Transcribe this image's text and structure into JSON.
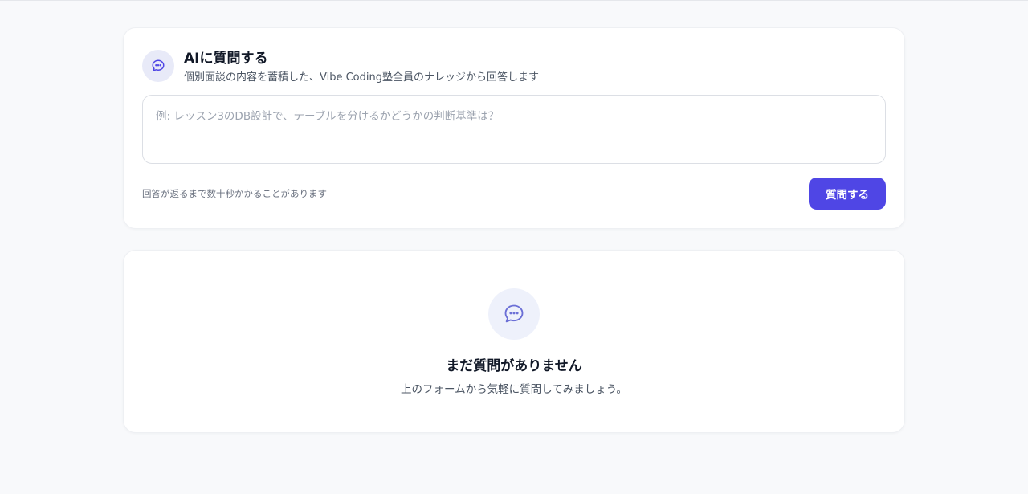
{
  "ask": {
    "icon": "chat-bubble-icon",
    "title": "AIに質問する",
    "subtitle": "個別面談の内容を蓄積した、Vibe Coding塾全員のナレッジから回答します",
    "question_value": "",
    "question_placeholder": "例: レッスン3のDB設計で、テーブルを分けるかどうかの判断基準は？",
    "hint": "回答が返るまで数十秒かかることがあります",
    "submit_label": "質問する"
  },
  "empty": {
    "icon": "chat-bubble-icon",
    "title": "まだ質問がありません",
    "description": "上のフォームから気軽に質問してみましょう。"
  },
  "colors": {
    "accent": "#4f46e5",
    "background": "#f8f9fb",
    "card": "#ffffff"
  }
}
